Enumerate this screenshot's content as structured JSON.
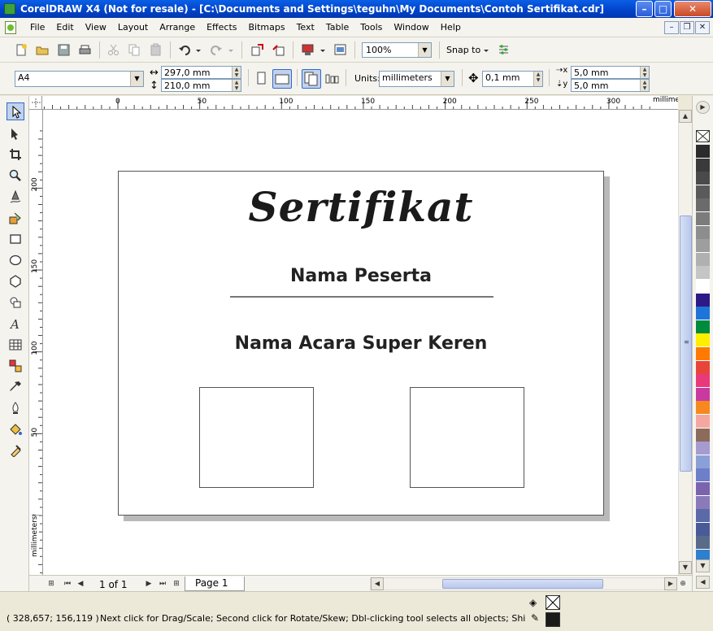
{
  "window": {
    "title": "CorelDRAW X4 (Not for resale) - [C:\\Documents and Settings\\teguhn\\My Documents\\Contoh Sertifikat.cdr]",
    "minimize": "–",
    "maximize": "□",
    "close": "✕"
  },
  "menu": {
    "items": [
      {
        "label": "File"
      },
      {
        "label": "Edit"
      },
      {
        "label": "View"
      },
      {
        "label": "Layout"
      },
      {
        "label": "Arrange"
      },
      {
        "label": "Effects"
      },
      {
        "label": "Bitmaps"
      },
      {
        "label": "Text"
      },
      {
        "label": "Table"
      },
      {
        "label": "Tools"
      },
      {
        "label": "Window"
      },
      {
        "label": "Help"
      }
    ],
    "doc_minimize": "–",
    "doc_restore": "❐",
    "doc_close": "✕"
  },
  "toolbar": {
    "zoom_value": "100%",
    "snap_to_label": "Snap to"
  },
  "property_bar": {
    "paper_size": "A4",
    "width": "297,0 mm",
    "height": "210,0 mm",
    "units_label": "Units:",
    "units_value": "millimeters",
    "nudge": "0,1 mm",
    "duplicate_x": "5,0 mm",
    "duplicate_y": "5,0 mm"
  },
  "rulers": {
    "h_labels": [
      "0",
      "50",
      "100",
      "150",
      "200",
      "250",
      "300"
    ],
    "h_unit": "millimeters",
    "v_labels": [
      "200",
      "150",
      "100",
      "50",
      "0"
    ],
    "v_unit": "millimeters"
  },
  "certificate": {
    "title": "Sertifikat",
    "participant": "Nama Peserta",
    "event": "Nama Acara Super Keren"
  },
  "page_nav": {
    "page_count": "1 of 1",
    "page_tab": "Page 1"
  },
  "status": {
    "coords": "( 328,657; 156,119 )",
    "hint": "Next click for Drag/Scale; Second click for Rotate/Skew; Dbl-clicking tool selects all objects; Shift+click mult..."
  },
  "palette": {
    "colors": [
      "#2b2b2b",
      "#3a3a3a",
      "#4a4a4a",
      "#5a5a5a",
      "#6b6b6b",
      "#7c7c7c",
      "#8d8d8d",
      "#9e9e9e",
      "#b0b0b0",
      "#c5c5c5",
      "#ffffff",
      "#2e1a87",
      "#1e74d9",
      "#008a3e",
      "#ffee00",
      "#ff7a00",
      "#e8443a",
      "#e83a7a",
      "#c93aa0",
      "#f5891f",
      "#f3a7a0",
      "#8c6b5a",
      "#a59bcf",
      "#8aa0d8",
      "#6c7fc8",
      "#7b63b0",
      "#8a7bb8",
      "#5a6aa8",
      "#4a5a98",
      "#5a6a8a",
      "#2f7fcf"
    ]
  }
}
